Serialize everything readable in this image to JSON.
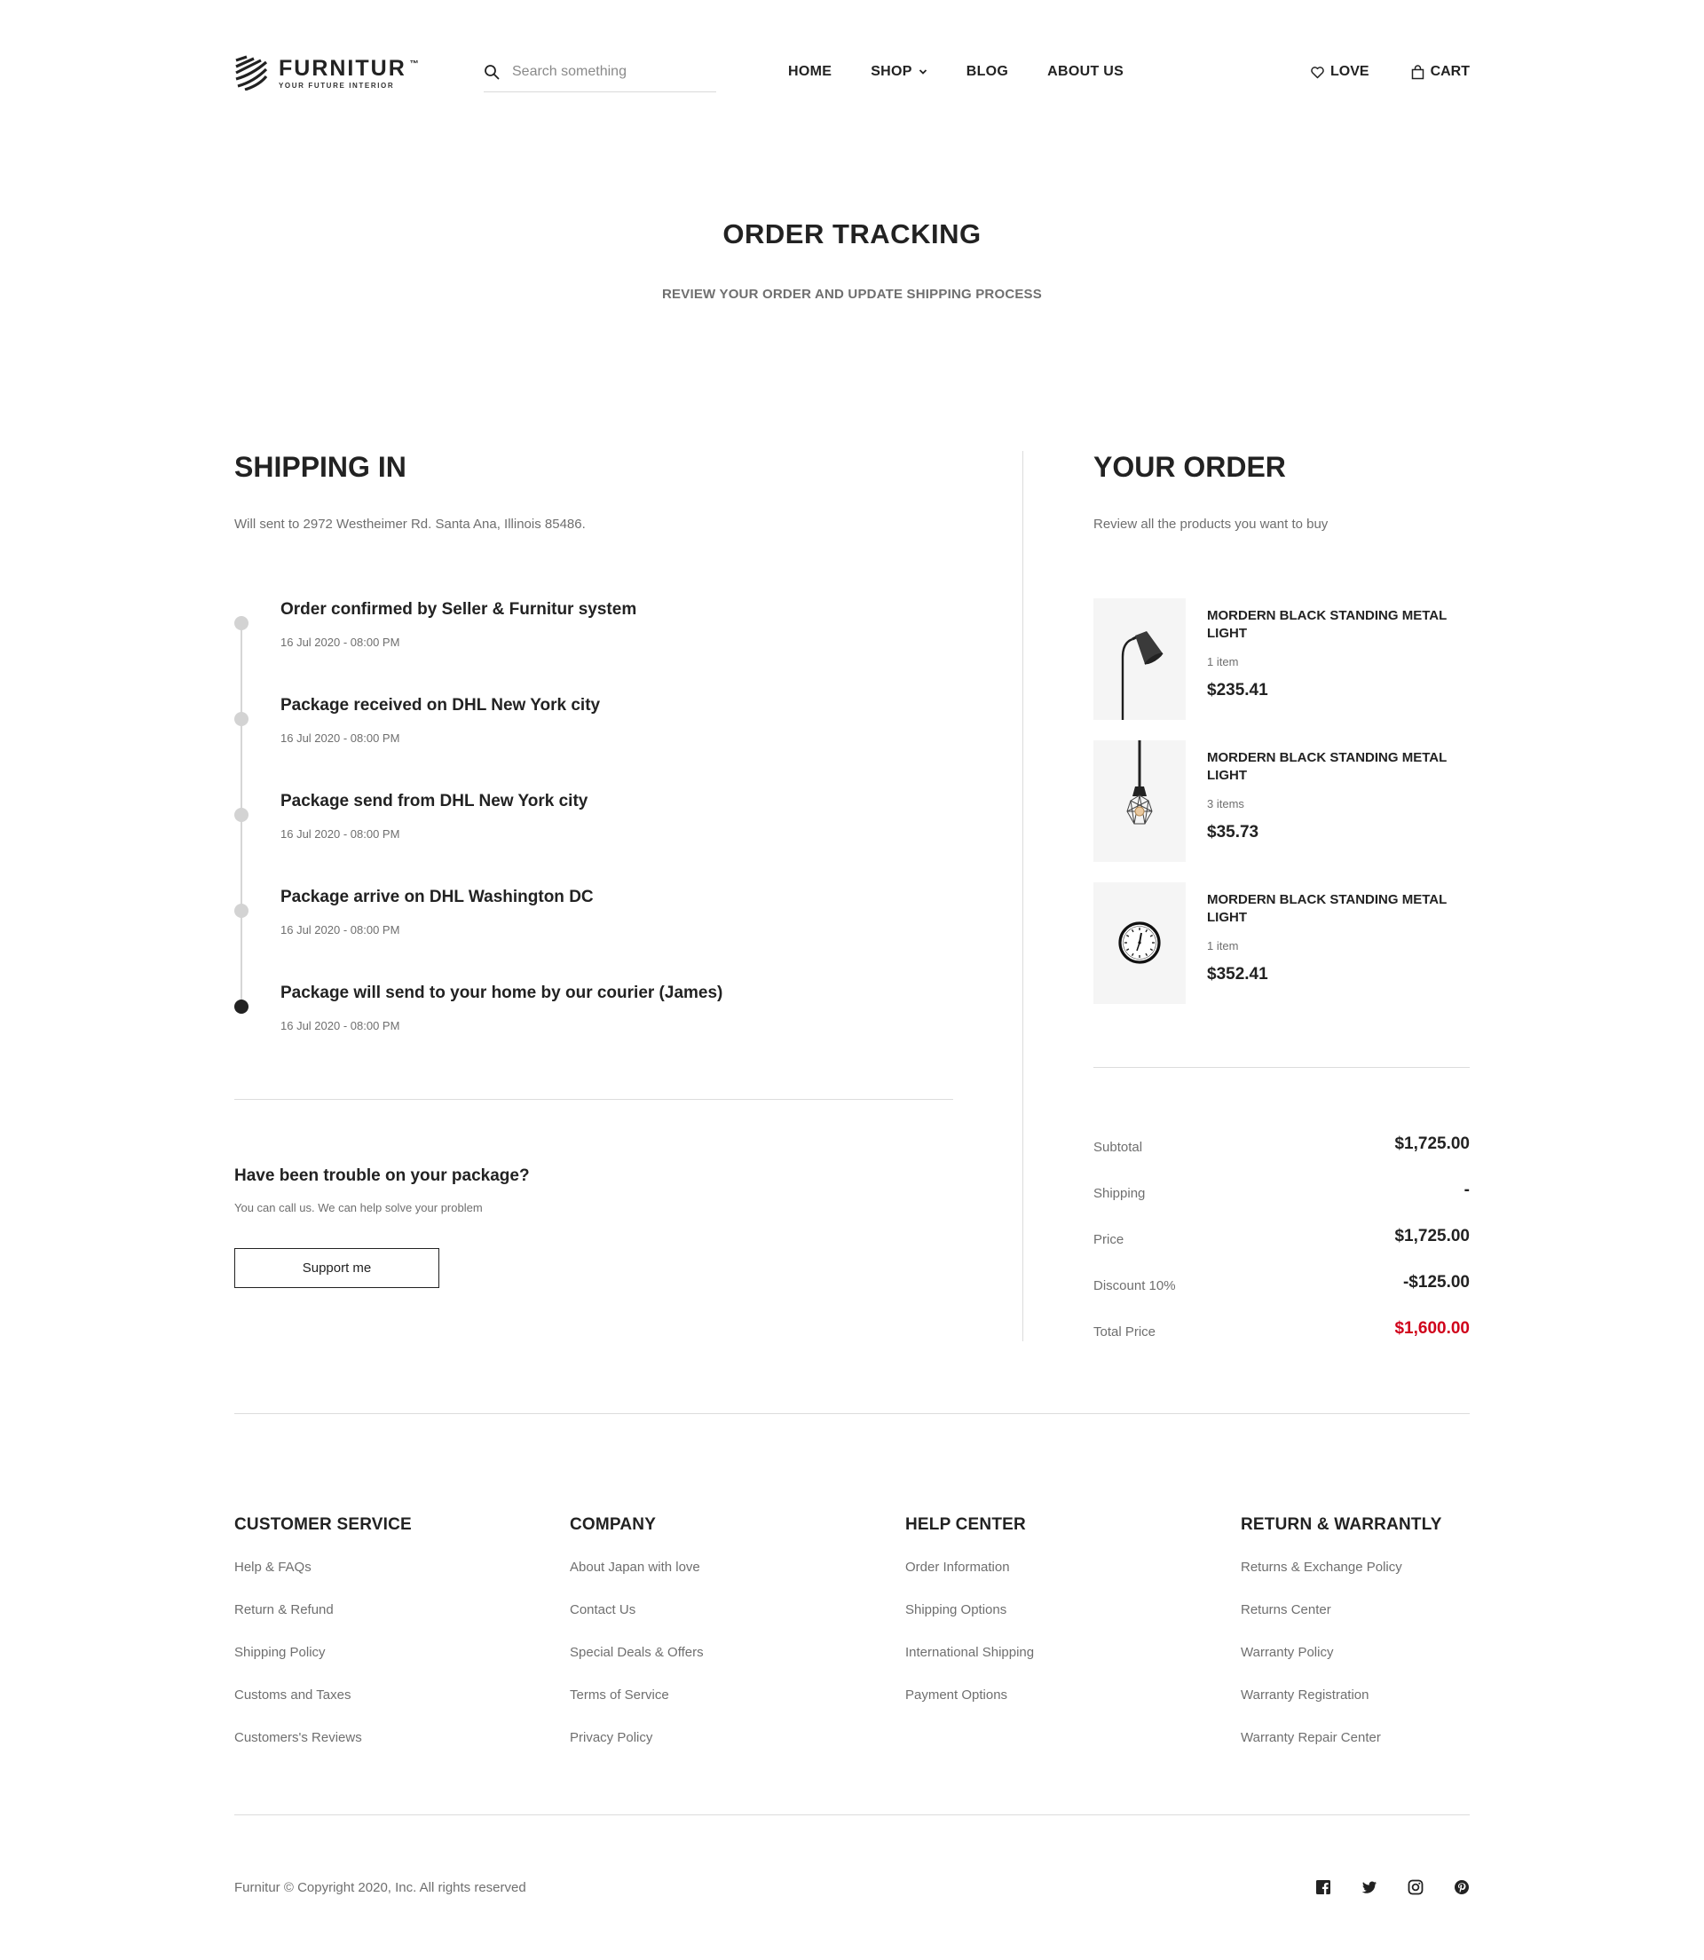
{
  "brand": {
    "name": "FURNITUR",
    "tm": "™",
    "tagline": "YOUR FUTURE INTERIOR"
  },
  "search": {
    "placeholder": "Search something",
    "icon": "search-icon"
  },
  "nav": {
    "home": "HOME",
    "shop": "SHOP",
    "blog": "BLOG",
    "about": "ABOUT US"
  },
  "actions": {
    "love": "LOVE",
    "cart": "CART"
  },
  "hero": {
    "title": "ORDER TRACKING",
    "subtitle": "REVIEW YOUR ORDER AND UPDATE SHIPPING PROCESS"
  },
  "shipping": {
    "title": "SHIPPING IN",
    "address": "Will sent to 2972 Westheimer Rd. Santa Ana, Illinois 85486.",
    "steps": [
      {
        "title": "Order confirmed by Seller & Furnitur system",
        "time": "16 Jul 2020 - 08:00 PM",
        "active": false
      },
      {
        "title": "Package received on DHL New York city",
        "time": "16 Jul 2020 - 08:00 PM",
        "active": false
      },
      {
        "title": "Package send from DHL New York city",
        "time": "16 Jul 2020 - 08:00 PM",
        "active": false
      },
      {
        "title": "Package arrive on DHL Washington DC",
        "time": "16 Jul 2020 - 08:00 PM",
        "active": false
      },
      {
        "title": "Package will send to your home by our courier (James)",
        "time": "16 Jul 2020 - 08:00 PM",
        "active": true
      }
    ],
    "trouble_title": "Have been trouble on your package?",
    "trouble_sub": "You can call us. We can help solve your problem",
    "support_label": "Support me"
  },
  "order": {
    "title": "YOUR ORDER",
    "subtitle": "Review all the products you want to buy",
    "products": [
      {
        "name": "MORDERN BLACK STANDING METAL LIGHT",
        "qty": "1 item",
        "price": "$235.41",
        "image": "standing-lamp-image"
      },
      {
        "name": "MORDERN BLACK STANDING METAL LIGHT",
        "qty": "3 items",
        "price": "$35.73",
        "image": "pendant-lamp-image"
      },
      {
        "name": "MORDERN BLACK STANDING METAL LIGHT",
        "qty": "1 item",
        "price": "$352.41",
        "image": "wall-clock-image"
      }
    ],
    "summary": {
      "subtotal_label": "Subtotal",
      "subtotal": "$1,725.00",
      "shipping_label": "Shipping",
      "shipping": "-",
      "price_label": "Price",
      "price": "$1,725.00",
      "discount_label": "Discount 10%",
      "discount": "-$125.00",
      "total_label": "Total Price",
      "total": "$1,600.00"
    }
  },
  "footer": {
    "columns": [
      {
        "title": "CUSTOMER SERVICE",
        "links": [
          "Help & FAQs",
          "Return & Refund",
          "Shipping Policy",
          "Customs and Taxes",
          "Customers's Reviews"
        ]
      },
      {
        "title": "COMPANY",
        "links": [
          "About Japan with love",
          "Contact Us",
          "Special Deals & Offers",
          "Terms of Service",
          "Privacy Policy"
        ]
      },
      {
        "title": "HELP CENTER",
        "links": [
          "Order Information",
          "Shipping Options",
          "International Shipping",
          "Payment Options"
        ]
      },
      {
        "title": "RETURN & WARRANTLY",
        "links": [
          "Returns & Exchange Policy",
          "Returns Center",
          "Warranty Policy",
          "Warranty Registration",
          "Warranty Repair Center"
        ]
      }
    ],
    "copyright": "Furnitur © Copyright 2020, Inc. All rights reserved",
    "socials": [
      "facebook-icon",
      "twitter-icon",
      "instagram-icon",
      "pinterest-icon"
    ]
  },
  "colors": {
    "text": "#222222",
    "muted": "#6f6f6f",
    "divider": "#dcdcdc",
    "total": "#d0021b",
    "timeline_inactive": "#d3d3d3"
  }
}
